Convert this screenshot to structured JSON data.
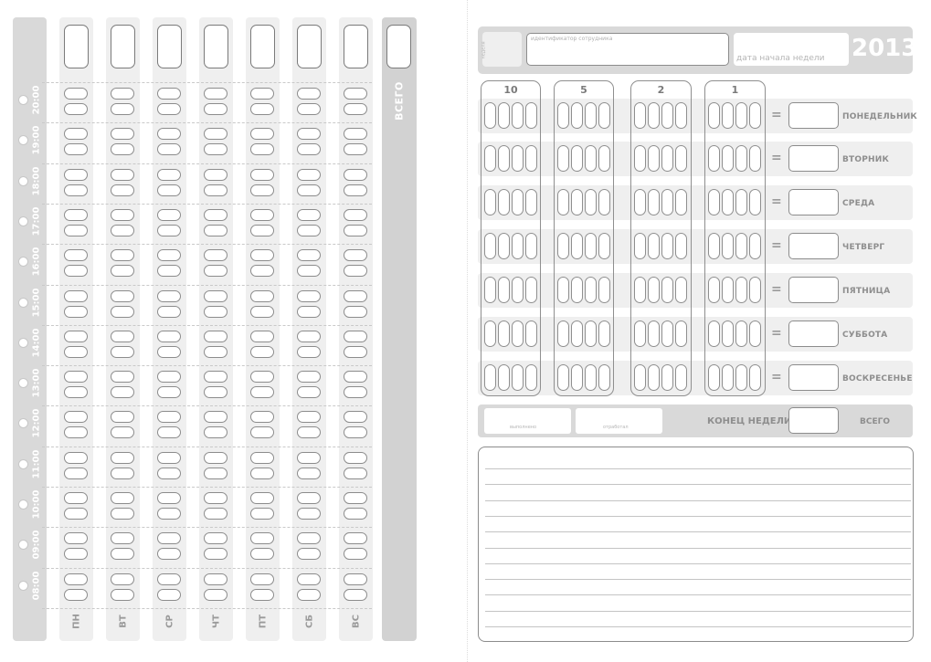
{
  "left": {
    "hours": [
      "20:00",
      "19:00",
      "18:00",
      "17:00",
      "16:00",
      "15:00",
      "14:00",
      "13:00",
      "12:00",
      "11:00",
      "10:00",
      "09:00",
      "08:00"
    ],
    "days": [
      "ПН",
      "ВТ",
      "СР",
      "ЧТ",
      "ПТ",
      "СБ",
      "ВС"
    ],
    "total_label": "ВСЕГО"
  },
  "header": {
    "small_label": "неделя",
    "employee_id_label": "идентификатор сотрудника",
    "week_start_label": "дата начала недели",
    "year": "2013"
  },
  "score_groups": [
    "10",
    "5",
    "2",
    "1"
  ],
  "weekdays": [
    "ПОНЕДЕЛЬНИК",
    "ВТОРНИК",
    "СРЕДА",
    "ЧЕТВЕРГ",
    "ПЯТНИЦА",
    "СУББОТА",
    "ВОСКРЕСЕНЬЕ"
  ],
  "equals": "=",
  "footer": {
    "field1_label": "выполнено",
    "field2_label": "отработал",
    "week_end_label": "КОНЕЦ НЕДЕЛИ",
    "total_label": "ВСЕГО"
  },
  "colors": {
    "band": "#efefef",
    "header_band": "#d9d9d9",
    "outline": "#8c8c8c"
  }
}
